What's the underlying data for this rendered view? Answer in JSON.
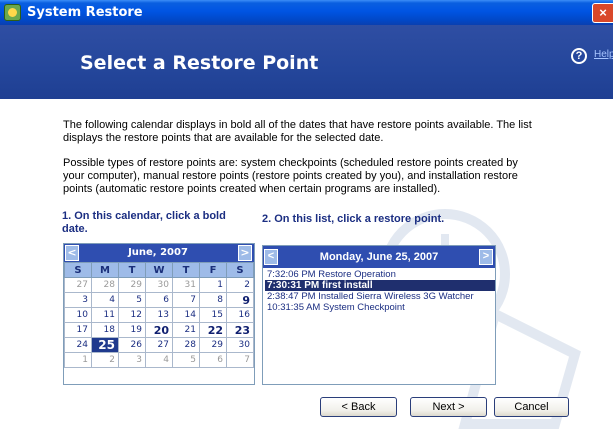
{
  "window": {
    "title": "System Restore",
    "close_glyph": "×"
  },
  "header": {
    "title": "Select a Restore Point",
    "help_icon": "?",
    "help_label": "Help"
  },
  "intro": {
    "paragraph1": "The following calendar displays in bold all of the dates that have restore points available. The list displays the restore points that are available for the selected date.",
    "paragraph2": "Possible types of restore points are: system checkpoints (scheduled restore points created by your computer), manual restore points (restore points created by you), and installation restore points (automatic restore points created when certain programs are installed)."
  },
  "steps": {
    "step1": "1. On this calendar, click a bold date.",
    "step2": "2. On this list, click a restore point."
  },
  "calendar": {
    "month_label": "June, 2007",
    "prev_glyph": "<",
    "next_glyph": ">",
    "weekdays": [
      "S",
      "M",
      "T",
      "W",
      "T",
      "F",
      "S"
    ],
    "weeks": [
      [
        {
          "d": "27",
          "t": "other"
        },
        {
          "d": "28",
          "t": "other"
        },
        {
          "d": "29",
          "t": "other"
        },
        {
          "d": "30",
          "t": "other"
        },
        {
          "d": "31",
          "t": "other"
        },
        {
          "d": "1",
          "t": ""
        },
        {
          "d": "2",
          "t": ""
        }
      ],
      [
        {
          "d": "3",
          "t": ""
        },
        {
          "d": "4",
          "t": ""
        },
        {
          "d": "5",
          "t": ""
        },
        {
          "d": "6",
          "t": ""
        },
        {
          "d": "7",
          "t": ""
        },
        {
          "d": "8",
          "t": ""
        },
        {
          "d": "9",
          "t": "bold"
        }
      ],
      [
        {
          "d": "10",
          "t": ""
        },
        {
          "d": "11",
          "t": ""
        },
        {
          "d": "12",
          "t": ""
        },
        {
          "d": "13",
          "t": ""
        },
        {
          "d": "14",
          "t": ""
        },
        {
          "d": "15",
          "t": ""
        },
        {
          "d": "16",
          "t": ""
        }
      ],
      [
        {
          "d": "17",
          "t": ""
        },
        {
          "d": "18",
          "t": ""
        },
        {
          "d": "19",
          "t": ""
        },
        {
          "d": "20",
          "t": "bold"
        },
        {
          "d": "21",
          "t": ""
        },
        {
          "d": "22",
          "t": "bold"
        },
        {
          "d": "23",
          "t": "bold"
        }
      ],
      [
        {
          "d": "24",
          "t": ""
        },
        {
          "d": "25",
          "t": "sel"
        },
        {
          "d": "26",
          "t": ""
        },
        {
          "d": "27",
          "t": ""
        },
        {
          "d": "28",
          "t": ""
        },
        {
          "d": "29",
          "t": ""
        },
        {
          "d": "30",
          "t": ""
        }
      ],
      [
        {
          "d": "1",
          "t": "other"
        },
        {
          "d": "2",
          "t": "other"
        },
        {
          "d": "3",
          "t": "other"
        },
        {
          "d": "4",
          "t": "other"
        },
        {
          "d": "5",
          "t": "other"
        },
        {
          "d": "6",
          "t": "other"
        },
        {
          "d": "7",
          "t": "other"
        }
      ]
    ]
  },
  "restore_list": {
    "date_label": "Monday, June 25, 2007",
    "prev_glyph": "<",
    "next_glyph": ">",
    "items": [
      {
        "text": "7:32:06 PM  Restore Operation",
        "selected": false
      },
      {
        "text": "7:30:31 PM  first install",
        "selected": true
      },
      {
        "text": "2:38:47 PM  Installed Sierra Wireless 3G Watcher",
        "selected": false
      },
      {
        "text": "10:31:35 AM  System Checkpoint",
        "selected": false
      }
    ]
  },
  "buttons": {
    "back": "< Back",
    "next": "Next >",
    "cancel": "Cancel"
  },
  "colors": {
    "title_bar": "#0054e3",
    "header_band": "#24469b",
    "calendar_header": "#2f4eb0",
    "selection": "#1f2f6e"
  }
}
